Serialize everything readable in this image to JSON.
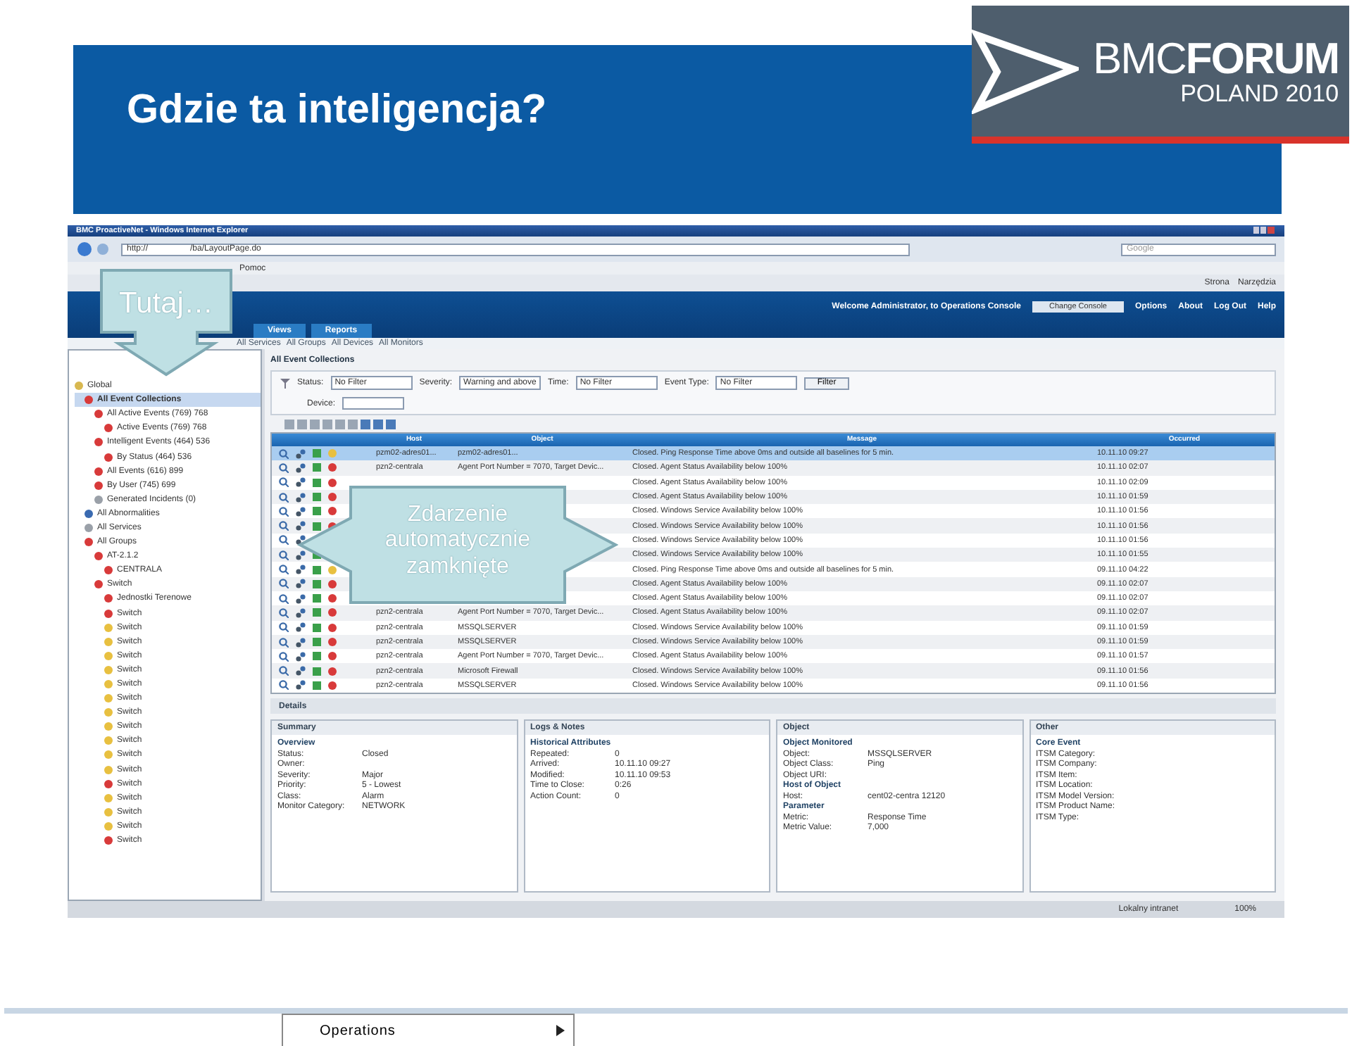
{
  "slide": {
    "title": "Gdzie ta inteligencja?",
    "logo": {
      "brand_light": "BMC",
      "brand_bold": "FORUM",
      "subtitle": "POLAND 2010"
    }
  },
  "browser": {
    "title": "BMC ProactiveNet - Windows Internet Explorer",
    "address": "http://",
    "address_path": "/ba/LayoutPage.do",
    "search_placeholder": "Google",
    "menu": [
      "Pomoc"
    ],
    "tools": [
      "Strona",
      "Narzędzia"
    ]
  },
  "app": {
    "welcome": "Welcome Administrator, to Operations Console",
    "console_button": "Change Console",
    "links": [
      "Options",
      "About",
      "Log Out",
      "Help"
    ],
    "tabs": [
      {
        "label": "Views",
        "selected": false
      },
      {
        "label": "Reports",
        "selected": false
      }
    ],
    "breadcrumb": [
      "All Services",
      "All Groups",
      "All Devices",
      "All Monitors"
    ]
  },
  "tree": [
    {
      "label": "Global",
      "color": "#d8b850",
      "selected": false,
      "children": [
        {
          "label": "All Event Collections",
          "color": "#d83a3a",
          "selected": true,
          "children": [
            {
              "label": "All Active Events (769) 768",
              "color": "#d83a3a",
              "selected": false,
              "children": [
                {
                  "label": "Active Events (769) 768",
                  "color": "#d83a3a",
                  "selected": false
                }
              ]
            },
            {
              "label": "Intelligent Events (464) 536",
              "color": "#d83a3a",
              "selected": false,
              "children": [
                {
                  "label": "By Status (464) 536",
                  "color": "#d83a3a",
                  "selected": false
                }
              ]
            },
            {
              "label": "All Events (616) 899",
              "color": "#d83a3a",
              "selected": false
            },
            {
              "label": "By User (745) 699",
              "color": "#d83a3a",
              "selected": false
            },
            {
              "label": "Generated Incidents (0)",
              "color": "#9aa0a8",
              "selected": false
            }
          ]
        },
        {
          "label": "All Abnormalities",
          "color": "#3a6ab0",
          "selected": false
        },
        {
          "label": "All Services",
          "color": "#9aa0a8",
          "selected": false
        },
        {
          "label": "All Groups",
          "color": "#d83a3a",
          "selected": false,
          "children": [
            {
              "label": "AT-2.1.2",
              "color": "#d83a3a",
              "selected": false,
              "children": [
                {
                  "label": "CENTRALA",
                  "color": "#d83a3a",
                  "selected": false
                }
              ]
            },
            {
              "label": "Switch",
              "color": "#d83a3a",
              "selected": false,
              "children": [
                {
                  "label": "Jednostki Terenowe",
                  "color": "#d83a3a",
                  "selected": false
                },
                {
                  "label": "Switch",
                  "color": "#d83a3a",
                  "selected": false
                },
                {
                  "label": "Switch",
                  "color": "#e8c040",
                  "selected": false
                },
                {
                  "label": "Switch",
                  "color": "#e8c040",
                  "selected": false
                },
                {
                  "label": "Switch",
                  "color": "#e8c040",
                  "selected": false
                },
                {
                  "label": "Switch",
                  "color": "#e8c040",
                  "selected": false
                },
                {
                  "label": "Switch",
                  "color": "#e8c040",
                  "selected": false
                },
                {
                  "label": "Switch",
                  "color": "#e8c040",
                  "selected": false
                },
                {
                  "label": "Switch",
                  "color": "#e8c040",
                  "selected": false
                },
                {
                  "label": "Switch",
                  "color": "#e8c040",
                  "selected": false
                },
                {
                  "label": "Switch",
                  "color": "#e8c040",
                  "selected": false
                },
                {
                  "label": "Switch",
                  "color": "#e8c040",
                  "selected": false
                },
                {
                  "label": "Switch",
                  "color": "#e8c040",
                  "selected": false
                },
                {
                  "label": "Switch",
                  "color": "#d83a3a",
                  "selected": false
                },
                {
                  "label": "Switch",
                  "color": "#e8c040",
                  "selected": false
                },
                {
                  "label": "Switch",
                  "color": "#e8c040",
                  "selected": false
                },
                {
                  "label": "Switch",
                  "color": "#e8c040",
                  "selected": false
                },
                {
                  "label": "Switch",
                  "color": "#d83a3a",
                  "selected": false
                }
              ]
            }
          ]
        }
      ]
    }
  ],
  "events": {
    "title": "All Event Collections",
    "filters": [
      {
        "label": "Status:",
        "value": "No Filter"
      },
      {
        "label": "Severity:",
        "value": "Warning and above"
      },
      {
        "label": "Time:",
        "value": "No Filter"
      },
      {
        "label": "Event Type:",
        "value": "No Filter"
      }
    ],
    "filter_button": "Filter",
    "device_label": "Device:",
    "columns": [
      "Host",
      "Object",
      "Message",
      "Occurred"
    ],
    "rows": [
      {
        "host": "pzm02-adres01...",
        "object": "pzm02-adres01...",
        "message": "Closed. Ping Response Time above 0ms and outside all baselines for 5 min.",
        "occurred": "10.11.10 09:27",
        "color": "#e8c040",
        "selected": true
      },
      {
        "host": "pzn2-centrala",
        "object": "Agent Port Number = 7070, Target Devic...",
        "message": "Closed. Agent Status Availability below 100%",
        "occurred": "10.11.10 02:07",
        "color": "#d83a3a",
        "selected": false
      },
      {
        "message": "Closed. Agent Status Availability below 100%",
        "occurred": "10.11.10 02:09",
        "color": "#d83a3a",
        "selected": false
      },
      {
        "message": "Closed. Agent Status Availability below 100%",
        "occurred": "10.11.10 01:59",
        "color": "#d83a3a",
        "selected": false
      },
      {
        "message": "Closed. Windows Service Availability below 100%",
        "occurred": "10.11.10 01:56",
        "color": "#d83a3a",
        "selected": false
      },
      {
        "message": "Closed. Windows Service Availability below 100%",
        "occurred": "10.11.10 01:56",
        "color": "#d83a3a",
        "selected": false
      },
      {
        "message": "Closed. Windows Service Availability below 100%",
        "occurred": "10.11.10 01:56",
        "selected": false
      },
      {
        "message": "Closed. Windows Service Availability below 100%",
        "occurred": "10.11.10 01:55",
        "selected": false
      },
      {
        "message": "Closed. Ping Response Time above 0ms and outside all baselines for 5 min.",
        "occurred": "09.11.10 04:22",
        "color": "#e8c040",
        "selected": false
      },
      {
        "message": "Closed. Agent Status Availability below 100%",
        "occurred": "09.11.10 02:07",
        "color": "#d83a3a",
        "selected": false
      },
      {
        "message": "Closed. Agent Status Availability below 100%",
        "occurred": "09.11.10 02:07",
        "color": "#d83a3a",
        "selected": false
      },
      {
        "host": "pzn2-centrala",
        "object": "Agent Port Number = 7070, Target Devic...",
        "message": "Closed. Agent Status Availability below 100%",
        "occurred": "09.11.10 02:07",
        "color": "#d83a3a",
        "selected": false
      },
      {
        "host": "pzn2-centrala",
        "object": "MSSQLSERVER",
        "message": "Closed. Windows Service Availability below 100%",
        "occurred": "09.11.10 01:59",
        "color": "#d83a3a",
        "selected": false
      },
      {
        "host": "pzn2-centrala",
        "object": "MSSQLSERVER",
        "message": "Closed. Windows Service Availability below 100%",
        "occurred": "09.11.10 01:59",
        "color": "#d83a3a",
        "selected": false
      },
      {
        "host": "pzn2-centrala",
        "object": "Agent Port Number = 7070, Target Devic...",
        "message": "Closed. Agent Status Availability below 100%",
        "occurred": "09.11.10 01:57",
        "color": "#d83a3a",
        "selected": false
      },
      {
        "host": "pzn2-centrala",
        "object": "Microsoft Firewall",
        "message": "Closed. Windows Service Availability below 100%",
        "occurred": "09.11.10 01:56",
        "color": "#d83a3a",
        "selected": false
      },
      {
        "host": "pzn2-centrala",
        "object": "MSSQLSERVER",
        "message": "Closed. Windows Service Availability below 100%",
        "occurred": "09.11.10 01:56",
        "color": "#d83a3a",
        "selected": false
      }
    ]
  },
  "details": {
    "title": "Details",
    "panels": [
      {
        "title": "Summary",
        "sections": [
          {
            "heading": "Overview",
            "fields": [
              {
                "label": "Status:",
                "value": "Closed"
              },
              {
                "label": "Owner:"
              },
              {
                "label": "Severity:",
                "value": "Major"
              },
              {
                "label": "Priority:",
                "value": "5 - Lowest"
              },
              {
                "label": "Class:",
                "value": "Alarm"
              },
              {
                "label": "Monitor Category:",
                "value": "NETWORK"
              }
            ]
          }
        ]
      },
      {
        "title": "Logs & Notes",
        "sections": [
          {
            "heading": "Historical Attributes",
            "fields": [
              {
                "label": "Repeated:",
                "value": "0"
              },
              {
                "label": "Arrived:",
                "value": "10.11.10 09:27"
              },
              {
                "label": "Modified:",
                "value": "10.11.10 09:53"
              },
              {
                "label": "Time to Close:",
                "value": "0:26"
              },
              {
                "label": "Action Count:",
                "value": "0"
              }
            ]
          }
        ]
      },
      {
        "title": "Object",
        "sections": [
          {
            "heading": "Object Monitored",
            "fields": [
              {
                "label": "Object:",
                "value": "MSSQLSERVER"
              },
              {
                "label": "Object Class:",
                "value": "Ping"
              },
              {
                "label": "Object URI:"
              }
            ]
          },
          {
            "heading": "Host of Object",
            "fields": [
              {
                "label": "Host:",
                "value": "cent02-centra 12120"
              }
            ]
          },
          {
            "heading": "Parameter",
            "fields": [
              {
                "label": "Metric:",
                "value": "Response Time"
              },
              {
                "label": "Metric Value:",
                "value": "7,000"
              }
            ]
          }
        ]
      },
      {
        "title": "Other",
        "sections": [
          {
            "heading": "Core Event",
            "fields": [
              {
                "label": "ITSM Category:"
              },
              {
                "label": "ITSM Company:"
              },
              {
                "label": "ITSM Item:"
              },
              {
                "label": "ITSM Location:"
              },
              {
                "label": "ITSM Model Version:"
              },
              {
                "label": "ITSM Product Name:"
              },
              {
                "label": "ITSM Type:"
              }
            ]
          }
        ]
      }
    ]
  },
  "status_bar": {
    "zone": "Lokalny intranet",
    "zoom": "100%"
  },
  "callouts": [
    {
      "kind": "down",
      "text": "Tutaj…"
    },
    {
      "kind": "double",
      "text": "Zdarzenie automatycznie zamknięte"
    }
  ],
  "bottom_menu": {
    "label": "Operations"
  }
}
